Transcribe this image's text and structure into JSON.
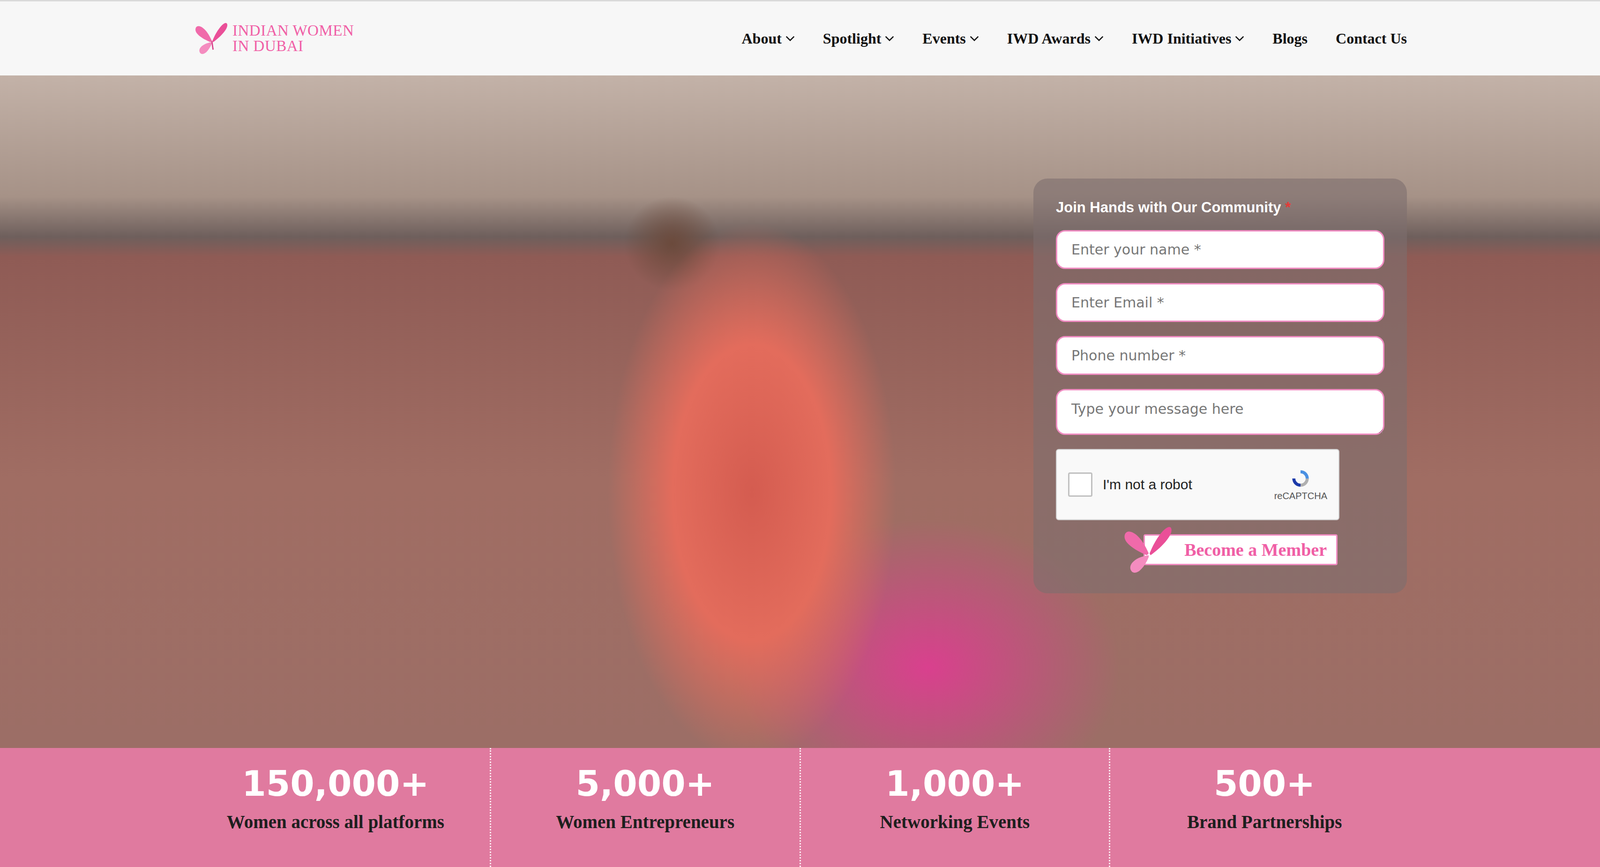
{
  "logo": {
    "line1": "INDIAN WOMEN",
    "line2": "IN DUBAI"
  },
  "nav": [
    {
      "label": "About",
      "dropdown": true
    },
    {
      "label": "Spotlight",
      "dropdown": true
    },
    {
      "label": "Events",
      "dropdown": true
    },
    {
      "label": "IWD Awards",
      "dropdown": true
    },
    {
      "label": "IWD Initiatives",
      "dropdown": true
    },
    {
      "label": "Blogs",
      "dropdown": false
    },
    {
      "label": "Contact Us",
      "dropdown": false
    }
  ],
  "form": {
    "title": "Join Hands with Our Community",
    "required_mark": "*",
    "fields": [
      {
        "placeholder": "Enter your name *",
        "kind": "input"
      },
      {
        "placeholder": "Enter Email *",
        "kind": "input"
      },
      {
        "placeholder": "Phone number *",
        "kind": "input"
      },
      {
        "placeholder": "Type your message here",
        "kind": "textarea"
      }
    ],
    "captcha": {
      "label": "I'm not a robot",
      "brand": "reCAPTCHA",
      "checked": false
    },
    "submit": "Become a Member"
  },
  "stats": [
    {
      "value": "150,000+",
      "label": "Women across all platforms"
    },
    {
      "value": "5,000+",
      "label": "Women Entrepreneurs"
    },
    {
      "value": "1,000+",
      "label": "Networking Events"
    },
    {
      "value": "500+",
      "label": "Brand Partnerships"
    }
  ]
}
